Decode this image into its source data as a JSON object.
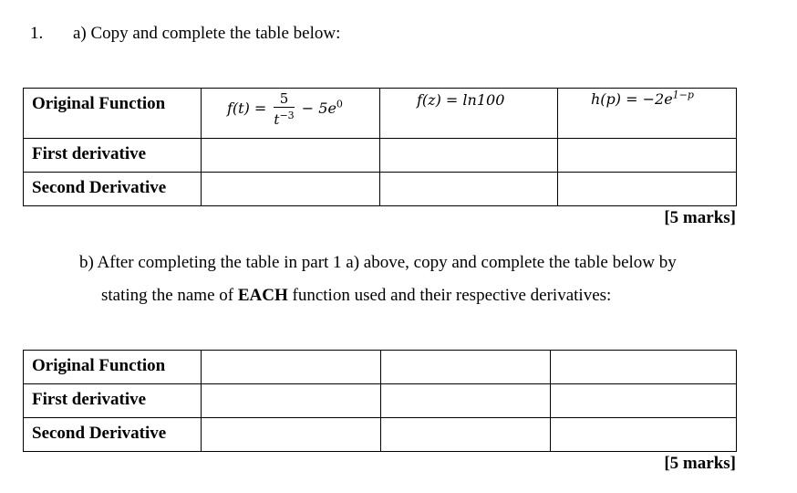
{
  "question": {
    "number": "1.",
    "part_a": {
      "instruction": "a) Copy and complete the table below:",
      "row_labels": [
        "Original Function",
        "First derivative",
        "Second Derivative"
      ],
      "functions": [
        {
          "lhs": "f(t) =",
          "numerator": "5",
          "denominator_base": "t",
          "denominator_exp": "−3",
          "tail": "− 5e",
          "tail_exp": "0"
        },
        {
          "lhs": "f(z) = ln100"
        },
        {
          "lhs": "h(p) = −2e",
          "exp": "1−p"
        }
      ],
      "marks": "[5 marks]"
    },
    "part_b": {
      "instruction_line1": "b) After completing the table in part 1 a) above, copy and complete the table below by",
      "instruction_line2_pre": "stating the name of ",
      "instruction_line2_bold": "EACH",
      "instruction_line2_post": " function used and their respective derivatives:",
      "row_labels": [
        "Original Function",
        "First derivative",
        "Second Derivative"
      ],
      "marks": "[5 marks]"
    }
  }
}
